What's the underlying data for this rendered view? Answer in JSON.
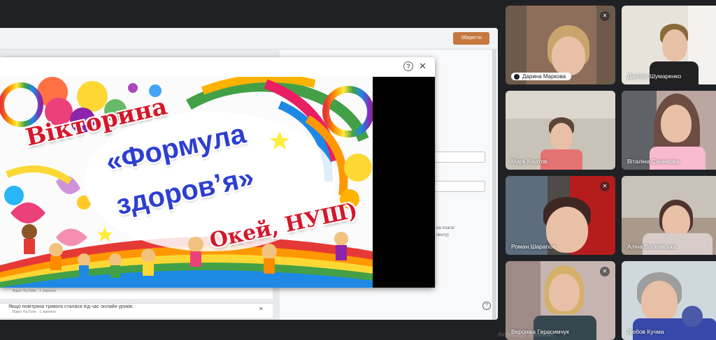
{
  "share": {
    "save_label": "Зберегти",
    "side_text_1": "на плагат",
    "side_text_2": "пенту)",
    "list_rows": [
      {
        "title": "Відео YouTube · 1 хвилина",
        "sub": ""
      },
      {
        "title": "Якщо повітряна тривога сталася під час онлайн уроків.",
        "sub": "Відео YouTube · 1 хвилина"
      }
    ]
  },
  "dialog": {
    "help_icon": "?",
    "close_icon": "✕"
  },
  "slide": {
    "word1": "Вікторина",
    "word2": "«Формула",
    "word3": "здоров’я»",
    "word4": "Окей, НУШ)"
  },
  "participants": [
    {
      "name": "Дарина Маркова",
      "muted": true,
      "mic_icon": "✕"
    },
    {
      "name": "Дмитро Шумаренко",
      "muted": false
    },
    {
      "name": "Марк Кічатов",
      "muted": false
    },
    {
      "name": "Віталіна Саннікова",
      "muted": false
    },
    {
      "name": "Роман Шарапов",
      "muted": true,
      "mic_icon": "✕"
    },
    {
      "name": "Аліна Волковська",
      "muted": false
    },
    {
      "name": "Вероніка Герасимчук",
      "muted": true,
      "mic_icon": "✕"
    },
    {
      "name": "Любов Кучма",
      "muted": false
    }
  ],
  "watermark": "Активація Windows",
  "colors": {
    "accent": "#8ab4f8",
    "save_button": "#c5773e",
    "title_red": "#d5172b",
    "title_blue": "#2d3fd1"
  }
}
